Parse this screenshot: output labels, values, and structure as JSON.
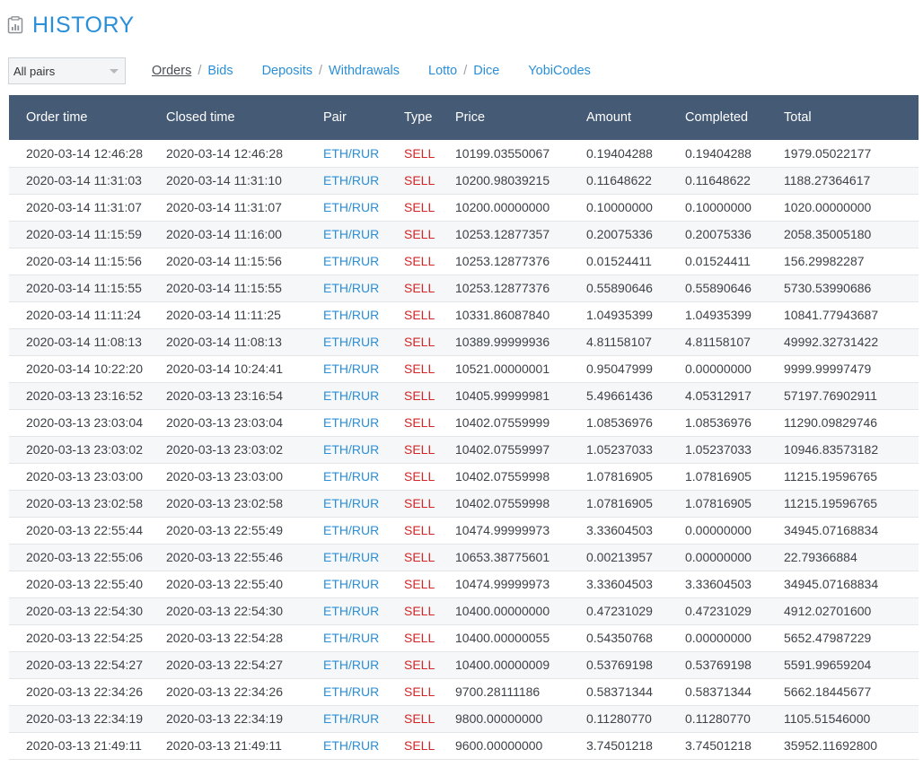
{
  "header": {
    "title": "HISTORY",
    "title_icon": "history-icon",
    "accent_color": "#2b8fd8"
  },
  "filter": {
    "pairs_selected": "All pairs"
  },
  "nav": {
    "orders": "Orders",
    "bids": "Bids",
    "deposits": "Deposits",
    "withdrawals": "Withdrawals",
    "lotto": "Lotto",
    "dice": "Dice",
    "yobicodes": "YobiCodes",
    "separator": "/"
  },
  "table": {
    "header_color": "#455a75",
    "sell_color": "#d22626",
    "columns": [
      "Order time",
      "Closed time",
      "Pair",
      "Type",
      "Price",
      "Amount",
      "Completed",
      "Total"
    ],
    "rows": [
      [
        "2020-03-14 12:46:28",
        "2020-03-14 12:46:28",
        "ETH/RUR",
        "SELL",
        "10199.03550067",
        "0.19404288",
        "0.19404288",
        "1979.05022177"
      ],
      [
        "2020-03-14 11:31:03",
        "2020-03-14 11:31:10",
        "ETH/RUR",
        "SELL",
        "10200.98039215",
        "0.11648622",
        "0.11648622",
        "1188.27364617"
      ],
      [
        "2020-03-14 11:31:07",
        "2020-03-14 11:31:07",
        "ETH/RUR",
        "SELL",
        "10200.00000000",
        "0.10000000",
        "0.10000000",
        "1020.00000000"
      ],
      [
        "2020-03-14 11:15:59",
        "2020-03-14 11:16:00",
        "ETH/RUR",
        "SELL",
        "10253.12877357",
        "0.20075336",
        "0.20075336",
        "2058.35005180"
      ],
      [
        "2020-03-14 11:15:56",
        "2020-03-14 11:15:56",
        "ETH/RUR",
        "SELL",
        "10253.12877376",
        "0.01524411",
        "0.01524411",
        "156.29982287"
      ],
      [
        "2020-03-14 11:15:55",
        "2020-03-14 11:15:55",
        "ETH/RUR",
        "SELL",
        "10253.12877376",
        "0.55890646",
        "0.55890646",
        "5730.53990686"
      ],
      [
        "2020-03-14 11:11:24",
        "2020-03-14 11:11:25",
        "ETH/RUR",
        "SELL",
        "10331.86087840",
        "1.04935399",
        "1.04935399",
        "10841.77943687"
      ],
      [
        "2020-03-14 11:08:13",
        "2020-03-14 11:08:13",
        "ETH/RUR",
        "SELL",
        "10389.99999936",
        "4.81158107",
        "4.81158107",
        "49992.32731422"
      ],
      [
        "2020-03-14 10:22:20",
        "2020-03-14 10:24:41",
        "ETH/RUR",
        "SELL",
        "10521.00000001",
        "0.95047999",
        "0.00000000",
        "9999.99997479"
      ],
      [
        "2020-03-13 23:16:52",
        "2020-03-13 23:16:54",
        "ETH/RUR",
        "SELL",
        "10405.99999981",
        "5.49661436",
        "4.05312917",
        "57197.76902911"
      ],
      [
        "2020-03-13 23:03:04",
        "2020-03-13 23:03:04",
        "ETH/RUR",
        "SELL",
        "10402.07559999",
        "1.08536976",
        "1.08536976",
        "11290.09829746"
      ],
      [
        "2020-03-13 23:03:02",
        "2020-03-13 23:03:02",
        "ETH/RUR",
        "SELL",
        "10402.07559997",
        "1.05237033",
        "1.05237033",
        "10946.83573182"
      ],
      [
        "2020-03-13 23:03:00",
        "2020-03-13 23:03:00",
        "ETH/RUR",
        "SELL",
        "10402.07559998",
        "1.07816905",
        "1.07816905",
        "11215.19596765"
      ],
      [
        "2020-03-13 23:02:58",
        "2020-03-13 23:02:58",
        "ETH/RUR",
        "SELL",
        "10402.07559998",
        "1.07816905",
        "1.07816905",
        "11215.19596765"
      ],
      [
        "2020-03-13 22:55:44",
        "2020-03-13 22:55:49",
        "ETH/RUR",
        "SELL",
        "10474.99999973",
        "3.33604503",
        "0.00000000",
        "34945.07168834"
      ],
      [
        "2020-03-13 22:55:06",
        "2020-03-13 22:55:46",
        "ETH/RUR",
        "SELL",
        "10653.38775601",
        "0.00213957",
        "0.00000000",
        "22.79366884"
      ],
      [
        "2020-03-13 22:55:40",
        "2020-03-13 22:55:40",
        "ETH/RUR",
        "SELL",
        "10474.99999973",
        "3.33604503",
        "3.33604503",
        "34945.07168834"
      ],
      [
        "2020-03-13 22:54:30",
        "2020-03-13 22:54:30",
        "ETH/RUR",
        "SELL",
        "10400.00000000",
        "0.47231029",
        "0.47231029",
        "4912.02701600"
      ],
      [
        "2020-03-13 22:54:25",
        "2020-03-13 22:54:28",
        "ETH/RUR",
        "SELL",
        "10400.00000055",
        "0.54350768",
        "0.00000000",
        "5652.47987229"
      ],
      [
        "2020-03-13 22:54:27",
        "2020-03-13 22:54:27",
        "ETH/RUR",
        "SELL",
        "10400.00000009",
        "0.53769198",
        "0.53769198",
        "5591.99659204"
      ],
      [
        "2020-03-13 22:34:26",
        "2020-03-13 22:34:26",
        "ETH/RUR",
        "SELL",
        "9700.28111186",
        "0.58371344",
        "0.58371344",
        "5662.18445677"
      ],
      [
        "2020-03-13 22:34:19",
        "2020-03-13 22:34:19",
        "ETH/RUR",
        "SELL",
        "9800.00000000",
        "0.11280770",
        "0.11280770",
        "1105.51546000"
      ],
      [
        "2020-03-13 21:49:11",
        "2020-03-13 21:49:11",
        "ETH/RUR",
        "SELL",
        "9600.00000000",
        "3.74501218",
        "3.74501218",
        "35952.11692800"
      ]
    ]
  }
}
